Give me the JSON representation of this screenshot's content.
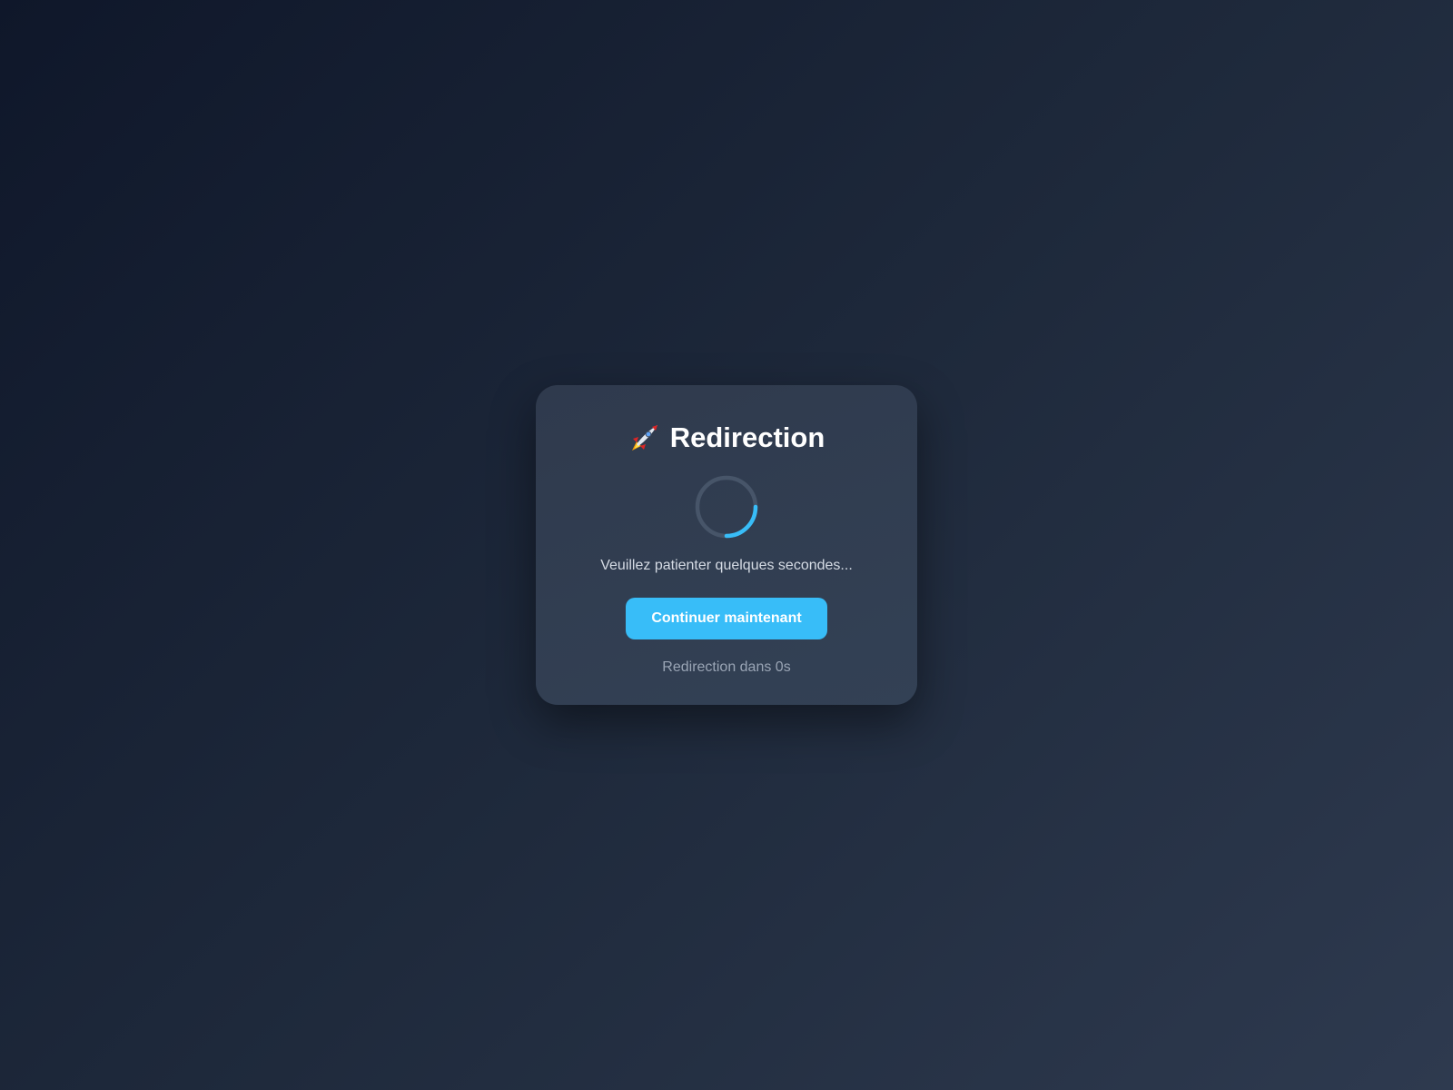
{
  "card": {
    "icon": "rocket-icon",
    "title": "Redirection",
    "message": "Veuillez patienter quelques secondes...",
    "button_label": "Continuer maintenant",
    "countdown_text": "Redirection dans 0s"
  },
  "colors": {
    "accent": "#38bdf8",
    "card_background": "#334155",
    "page_background": "#0f172a"
  }
}
